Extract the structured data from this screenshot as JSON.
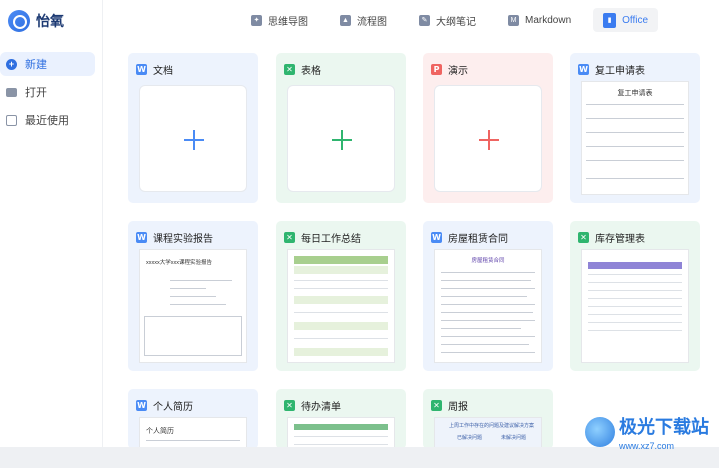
{
  "app": {
    "name": "怡氧"
  },
  "sidebar": {
    "items": [
      {
        "label": "新建",
        "icon": "plus-circle-icon",
        "active": true
      },
      {
        "label": "打开",
        "icon": "folder-icon"
      },
      {
        "label": "最近使用",
        "icon": "recent-doc-icon"
      }
    ]
  },
  "tabs": [
    {
      "label": "思维导图",
      "icon": "mindmap-icon"
    },
    {
      "label": "流程图",
      "icon": "flowchart-icon"
    },
    {
      "label": "大纲笔记",
      "icon": "outline-icon"
    },
    {
      "label": "Markdown",
      "icon": "markdown-icon"
    },
    {
      "label": "Office",
      "icon": "office-icon",
      "active": true
    }
  ],
  "cards": [
    {
      "label": "文档",
      "type": "W"
    },
    {
      "label": "表格",
      "type": "X"
    },
    {
      "label": "演示",
      "type": "P"
    },
    {
      "label": "复工申请表",
      "type": "W",
      "preview_title": "复工申请表"
    },
    {
      "label": "课程实验报告",
      "type": "W",
      "preview_title": "xxxxx大学xxx课程实验报告"
    },
    {
      "label": "每日工作总结",
      "type": "X",
      "preview_title": "每日工作总结"
    },
    {
      "label": "房屋租赁合同",
      "type": "W",
      "preview_title": "房屋租赁合同"
    },
    {
      "label": "库存管理表",
      "type": "X",
      "preview_title": "库存管理表"
    },
    {
      "label": "个人简历",
      "type": "W",
      "preview_title": "个人简历"
    },
    {
      "label": "待办清单",
      "type": "X",
      "preview_title": "待办清单"
    },
    {
      "label": "周报",
      "type": "X",
      "preview_title": "上周工作中存在的问题及建议解决方案",
      "preview_cols": [
        "已解决问题",
        "未解决问题"
      ]
    }
  ],
  "colors": {
    "accent": "#3b7cf0",
    "word": "#4a8bf5",
    "excel": "#2fb56f",
    "ppt": "#ef6461"
  },
  "watermark": {
    "text": "极光下载站",
    "sub": "www.xz7.com"
  }
}
